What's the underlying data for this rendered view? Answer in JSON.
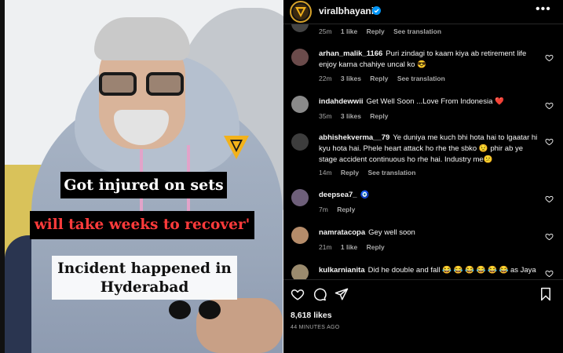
{
  "post_image": {
    "caption_line1": "Got injured on sets",
    "caption_line2": "will take weeks to recover'",
    "caption_line3": "Incident happened in Hyderabad"
  },
  "header": {
    "username": "viralbhayani",
    "verified_icon": "verified-badge-icon",
    "more_icon": "more-options-icon",
    "more_label": "•••"
  },
  "comments": [
    {
      "username": "",
      "text": "",
      "time": "25m",
      "likes": "1 like",
      "reply": "Reply",
      "translation": "See translation"
    },
    {
      "username": "arhan_malik_1166",
      "text": "Puri zindagi to kaam kiya ab retirement life enjoy karna chahiye uncal ko 😎",
      "time": "22m",
      "likes": "3 likes",
      "reply": "Reply",
      "translation": "See translation"
    },
    {
      "username": "indahdewwii",
      "text": "Get Well Soon ...Love From Indonesia ❤️",
      "time": "35m",
      "likes": "3 likes",
      "reply": "Reply",
      "translation": ""
    },
    {
      "username": "abhishekverma__79",
      "text": "Ye duniya me kuch bhi hota hai to lgaatar hi kyu hota hai. Phele heart attack ho rhe the sbko 😟 phir ab ye stage accident continuous ho rhe hai. Industry me😕",
      "time": "14m",
      "likes": "",
      "reply": "Reply",
      "translation": "See translation"
    },
    {
      "username": "deepsea7_",
      "text": "🧿",
      "time": "7m",
      "likes": "",
      "reply": "Reply",
      "translation": ""
    },
    {
      "username": "namratacopa",
      "text": "Gey well soon",
      "time": "21m",
      "likes": "1 like",
      "reply": "Reply",
      "translation": ""
    },
    {
      "username": "kulkarnianita",
      "text": "Did he double and fall 😂 😂 😂 😂 😂 😂 as Jaya",
      "time": "",
      "likes": "",
      "reply": "",
      "translation": ""
    }
  ],
  "actions": {
    "like_icon": "heart-outline-icon",
    "comment_icon": "comment-icon",
    "share_icon": "share-icon",
    "save_icon": "bookmark-icon"
  },
  "likes_count": "8,618 likes",
  "posted_time": "44 MINUTES AGO",
  "colors": {
    "background": "#000000",
    "text_primary": "#f5f5f5",
    "text_secondary": "#a8a8a8",
    "heart_red": "#ff3040",
    "verified_blue": "#0095f6",
    "caption_red": "#ff3b3b"
  }
}
